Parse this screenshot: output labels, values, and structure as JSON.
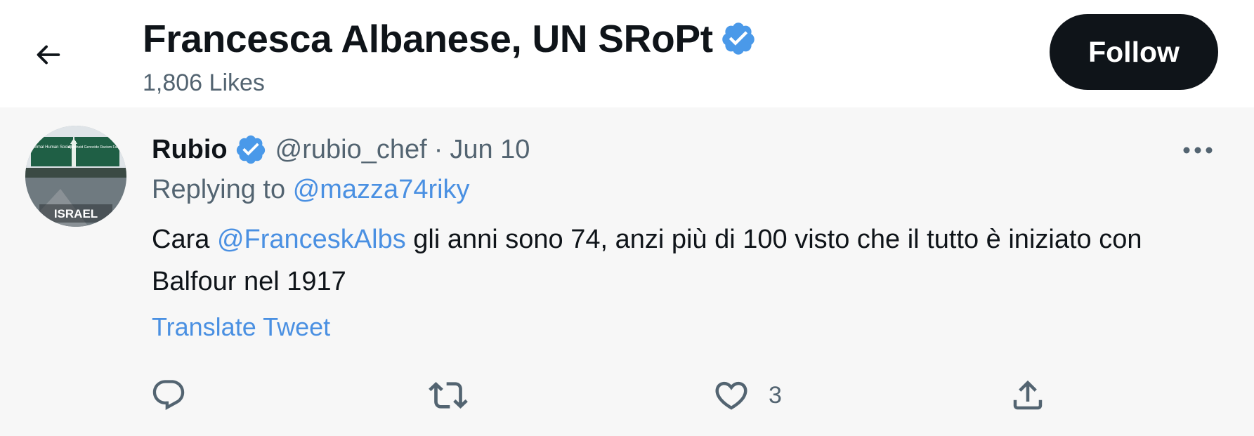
{
  "header": {
    "title": "Francesca Albanese, UN SRoPt",
    "likes": "1,806 Likes",
    "follow_label": "Follow",
    "back_icon": "arrow-left-icon",
    "verified_icon": "verified-badge-icon"
  },
  "tweet": {
    "author_name": "Rubio",
    "handle": "@rubio_chef",
    "separator": "·",
    "date": "Jun 10",
    "replying_prefix": "Replying to",
    "replying_to": "@mazza74riky",
    "text_prefix": "Cara",
    "mention": "@FranceskAlbs",
    "text_rest": "gli anni sono 74, anzi più di 100 visto che il tutto è iniziato con Balfour nel 1917",
    "translate_label": "Translate Tweet",
    "avatar": {
      "sign_left": "Normal Human Society",
      "sign_right": "Apartheid Genocide Racism Fascism",
      "caption": "ISRAEL"
    },
    "actions": {
      "reply_icon": "reply-icon",
      "retweet_icon": "retweet-icon",
      "like_icon": "heart-icon",
      "like_count": "3",
      "share_icon": "share-icon"
    }
  },
  "colors": {
    "accent": "#4a90e2",
    "verified": "#4a99e9",
    "text_primary": "#0f1419",
    "text_secondary": "#536471",
    "tweet_background": "#f7f7f7",
    "follow_background": "#0f1419"
  }
}
